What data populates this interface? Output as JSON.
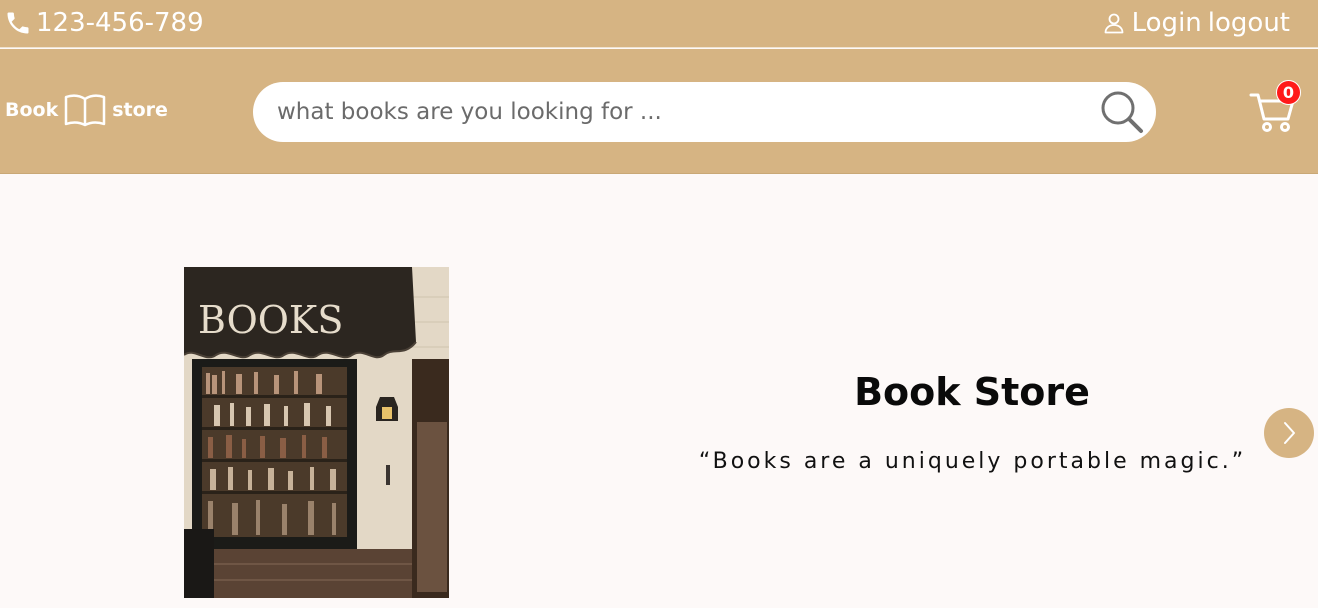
{
  "topbar": {
    "phone": "123-456-789",
    "login": "Login",
    "logout": "logout"
  },
  "header": {
    "logo_left": "Book",
    "logo_right": "store",
    "search_placeholder": "what books are you looking for ...",
    "cart_count": "0"
  },
  "hero": {
    "title": "Book Store",
    "quote": "“Books are a uniquely portable magic.”",
    "image_sign": "BOOKS"
  },
  "colors": {
    "brand": "#d6b483",
    "background": "#fdf9f8",
    "badge": "#ff1a1a"
  }
}
